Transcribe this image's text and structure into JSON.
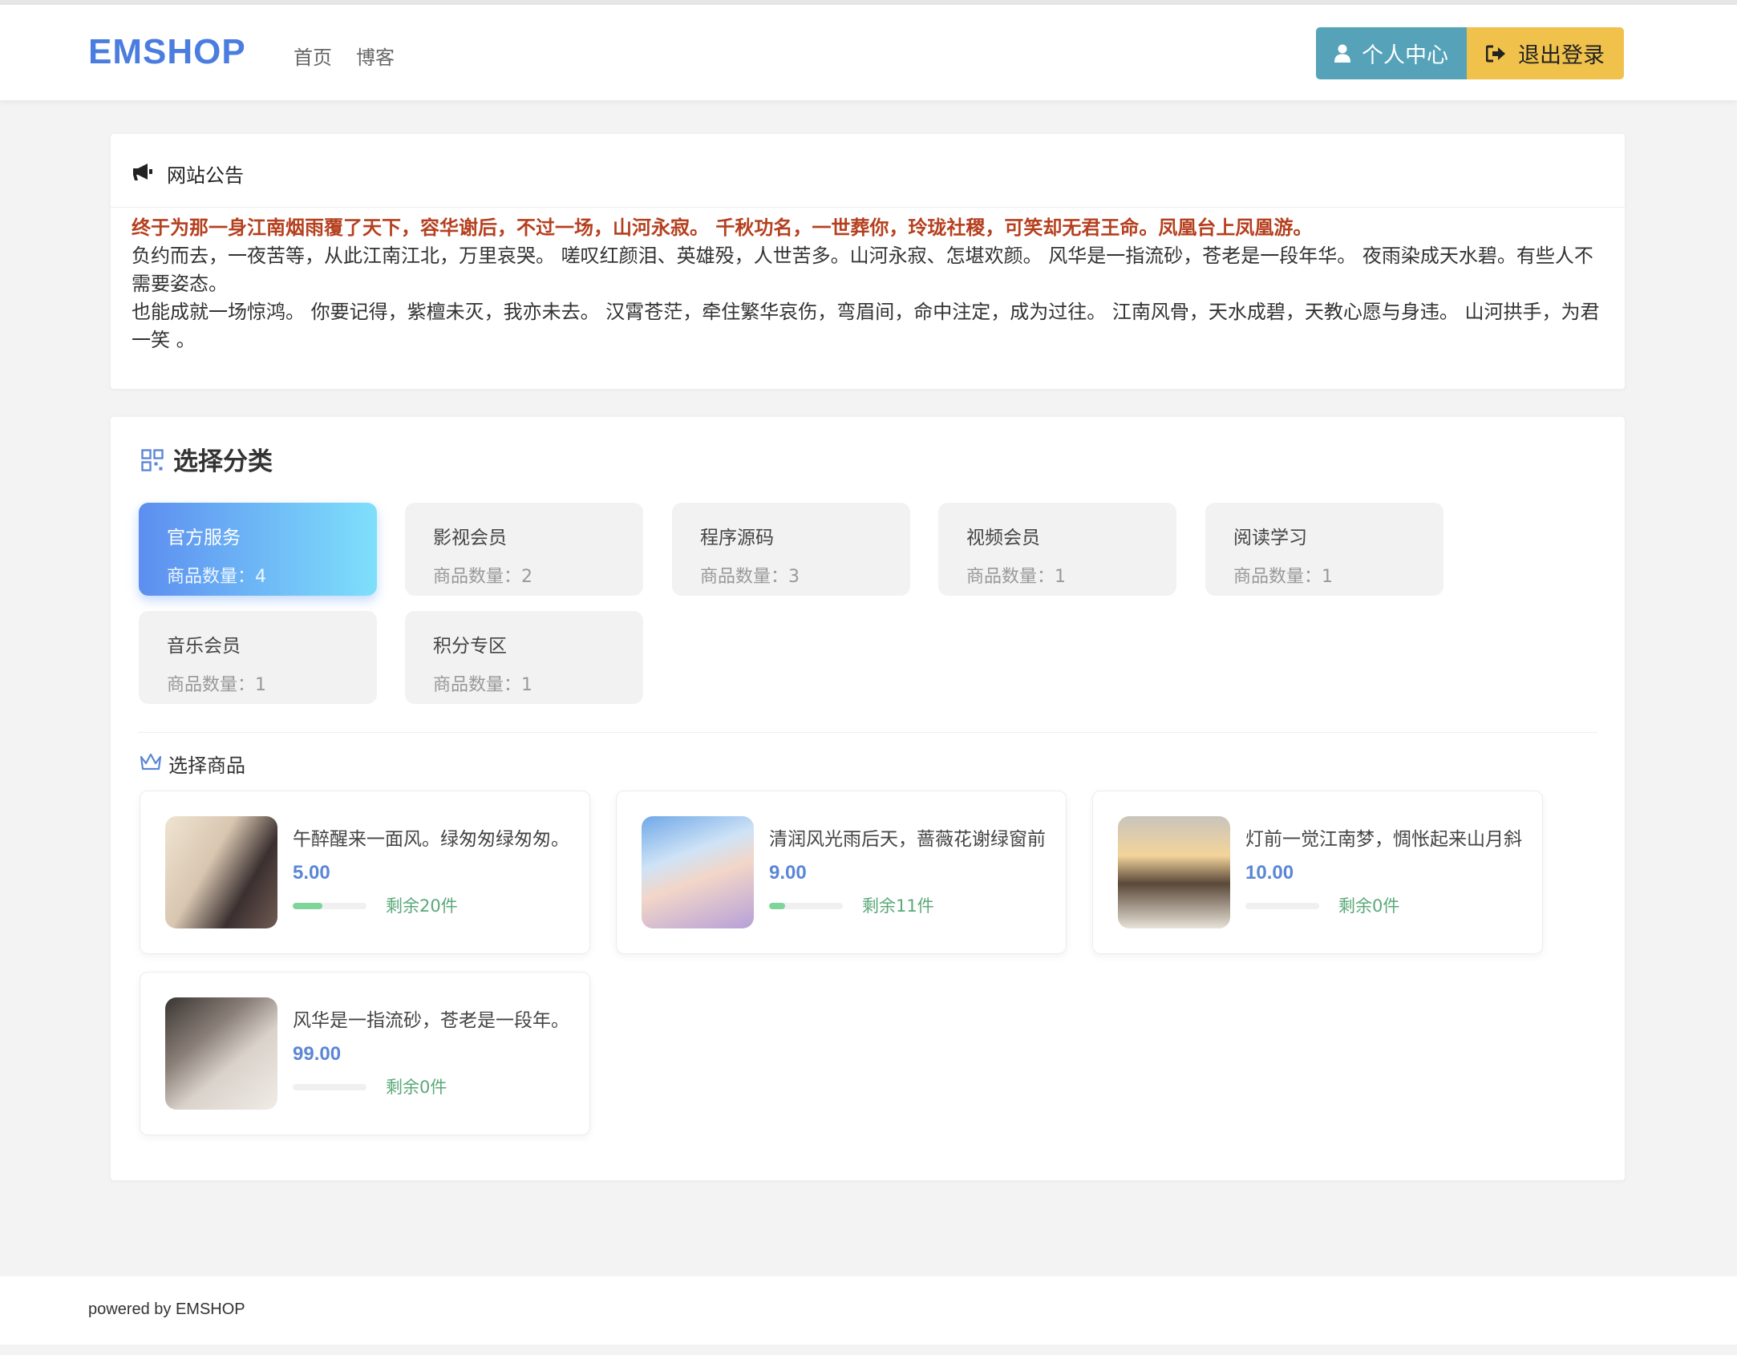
{
  "header": {
    "brand": "EMSHOP",
    "nav": [
      "首页",
      "博客"
    ],
    "user_center": "个人中心",
    "logout": "退出登录"
  },
  "notice": {
    "title": "网站公告",
    "highlight": "终于为那一身江南烟雨覆了天下，容华谢后，不过一场，山河永寂。 千秋功名，一世葬你，玲珑社稷，可笑却无君王命。凤凰台上凤凰游。",
    "line1": "负约而去，一夜苦等，从此江南江北，万里哀哭。 嗟叹红颜泪、英雄殁，人世苦多。山河永寂、怎堪欢颜。 风华是一指流砂，苍老是一段年华。 夜雨染成天水碧。有些人不需要姿态。",
    "line2": "也能成就一场惊鸿。 你要记得，紫檀未灭，我亦未去。 汉霄苍茫，牵住繁华哀伤，弯眉间，命中注定，成为过往。 江南风骨，天水成碧，天教心愿与身违。 山河拱手，为君一笑 。"
  },
  "categories": {
    "title": "选择分类",
    "items": [
      {
        "name": "官方服务",
        "count": "商品数量：4"
      },
      {
        "name": "影视会员",
        "count": "商品数量：2"
      },
      {
        "name": "程序源码",
        "count": "商品数量：3"
      },
      {
        "name": "视频会员",
        "count": "商品数量：1"
      },
      {
        "name": "阅读学习",
        "count": "商品数量：1"
      },
      {
        "name": "音乐会员",
        "count": "商品数量：1"
      },
      {
        "name": "积分专区",
        "count": "商品数量：1"
      }
    ]
  },
  "goods": {
    "title": "选择商品",
    "items": [
      {
        "name": "午醉醒来一面风。绿匆匆绿匆匆。",
        "price": "5.00",
        "stock": "剩余20件",
        "stock_fill": 0.4
      },
      {
        "name": "清润风光雨后天，蔷薇花谢绿窗前",
        "price": "9.00",
        "stock": "剩余11件",
        "stock_fill": 0.22
      },
      {
        "name": "灯前一觉江南梦，惆怅起来山月斜",
        "price": "10.00",
        "stock": "剩余0件",
        "stock_fill": 0
      },
      {
        "name": "风华是一指流砂，苍老是一段年。",
        "price": "99.00",
        "stock": "剩余0件",
        "stock_fill": 0
      }
    ]
  },
  "footer": {
    "text": "powered by EMSHOP"
  },
  "colors": {
    "brand": "#4a7ddf",
    "user_button": "#56a3b9",
    "logout_button": "#f0c14b",
    "notice_highlight": "#b5401f",
    "price": "#5b86d6",
    "stock": "#5aa878"
  },
  "icons": [
    "user-icon",
    "sign-out-icon",
    "bullhorn-icon",
    "grid-icon",
    "crown-icon"
  ]
}
